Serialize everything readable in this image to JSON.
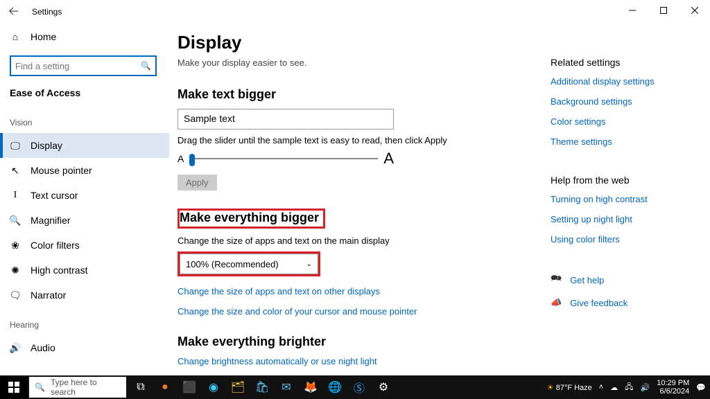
{
  "window": {
    "title": "Settings"
  },
  "sidebar": {
    "home": "Home",
    "search_placeholder": "Find a setting",
    "section": "Ease of Access",
    "group_vision": "Vision",
    "group_hearing": "Hearing",
    "vision_items": [
      {
        "label": "Display"
      },
      {
        "label": "Mouse pointer"
      },
      {
        "label": "Text cursor"
      },
      {
        "label": "Magnifier"
      },
      {
        "label": "Color filters"
      },
      {
        "label": "High contrast"
      },
      {
        "label": "Narrator"
      }
    ],
    "hearing_items": [
      {
        "label": "Audio"
      }
    ]
  },
  "main": {
    "heading": "Display",
    "subtitle": "Make your display easier to see.",
    "text_bigger": {
      "title": "Make text bigger",
      "sample": "Sample text",
      "hint": "Drag the slider until the sample text is easy to read, then click Apply",
      "small_a": "A",
      "big_a": "A",
      "apply": "Apply"
    },
    "everything_bigger": {
      "title": "Make everything bigger",
      "sub": "Change the size of apps and text on the main display",
      "value": "100% (Recommended)",
      "link1": "Change the size of apps and text on other displays",
      "link2": "Change the size and color of your cursor and mouse pointer"
    },
    "brighter": {
      "title": "Make everything brighter",
      "link": "Change brightness automatically or use night light"
    }
  },
  "right": {
    "related_head": "Related settings",
    "related": [
      "Additional display settings",
      "Background settings",
      "Color settings",
      "Theme settings"
    ],
    "help_head": "Help from the web",
    "help": [
      "Turning on high contrast",
      "Setting up night light",
      "Using color filters"
    ],
    "get_help": "Get help",
    "feedback": "Give feedback"
  },
  "taskbar": {
    "search": "Type here to search",
    "weather": "87°F Haze",
    "time": "10:29 PM",
    "date": "6/6/2024"
  }
}
